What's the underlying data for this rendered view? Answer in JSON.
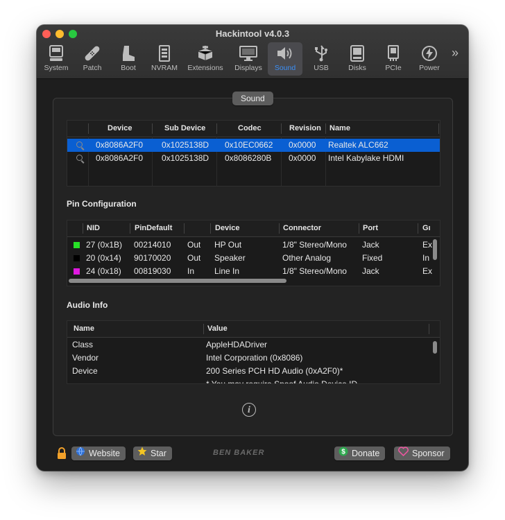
{
  "window": {
    "title": "Hackintool v4.0.3"
  },
  "toolbar": {
    "items": [
      {
        "label": "System",
        "icon": "system-icon"
      },
      {
        "label": "Patch",
        "icon": "patch-icon"
      },
      {
        "label": "Boot",
        "icon": "boot-icon"
      },
      {
        "label": "NVRAM",
        "icon": "nvram-icon"
      },
      {
        "label": "Extensions",
        "icon": "extensions-icon"
      },
      {
        "label": "Displays",
        "icon": "displays-icon"
      },
      {
        "label": "Sound",
        "icon": "sound-icon",
        "active": true
      },
      {
        "label": "USB",
        "icon": "usb-icon"
      },
      {
        "label": "Disks",
        "icon": "disks-icon"
      },
      {
        "label": "PCIe",
        "icon": "pcie-icon"
      },
      {
        "label": "Power",
        "icon": "power-icon"
      }
    ],
    "more": "»"
  },
  "panel": {
    "tab_label": "Sound"
  },
  "devices": {
    "columns": [
      "Device",
      "Sub Device",
      "Codec",
      "Revision",
      "Name"
    ],
    "rows": [
      [
        "0x8086A2F0",
        "0x1025138D",
        "0x10EC0662",
        "0x0000",
        "Realtek ALC662"
      ],
      [
        "0x8086A2F0",
        "0x1025138D",
        "0x8086280B",
        "0x0000",
        "Intel Kabylake HDMI"
      ]
    ]
  },
  "pin_config": {
    "title": "Pin Configuration",
    "columns": [
      "NID",
      "PinDefault",
      "",
      "Device",
      "Connector",
      "Port",
      "Gı"
    ],
    "rows": [
      {
        "color": "#27e027",
        "cells": [
          "27 (0x1B)",
          "00214010",
          "Out",
          "HP Out",
          "1/8\" Stereo/Mono",
          "Jack",
          "Ex"
        ]
      },
      {
        "color": "#000000",
        "cells": [
          "20 (0x14)",
          "90170020",
          "Out",
          "Speaker",
          "Other Analog",
          "Fixed",
          "In"
        ]
      },
      {
        "color": "#e019e0",
        "cells": [
          "24 (0x18)",
          "00819030",
          "In",
          "Line In",
          "1/8\" Stereo/Mono",
          "Jack",
          "Ex"
        ]
      }
    ]
  },
  "audio_info": {
    "title": "Audio Info",
    "columns": [
      "Name",
      "Value"
    ],
    "rows": [
      [
        "Class",
        "AppleHDADriver"
      ],
      [
        "Vendor",
        "Intel Corporation (0x8086)"
      ],
      [
        "Device",
        "200 Series PCH HD Audio (0xA2F0)*"
      ],
      [
        "",
        "* You may require Spoof Audio Device ID"
      ]
    ]
  },
  "footer": {
    "website_label": "Website",
    "star_label": "Star",
    "brand": "BEN BAKER",
    "donate_label": "Donate",
    "sponsor_label": "Sponsor"
  },
  "colors": {
    "accent": "#0a5fd2",
    "active_tab_text": "#3b8ff7"
  }
}
